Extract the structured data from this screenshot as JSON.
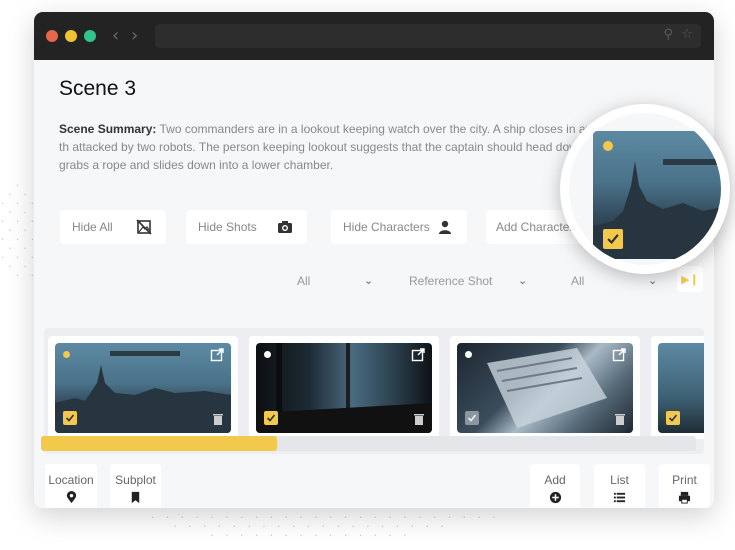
{
  "window": {
    "traffic_lights": [
      "#e8664a",
      "#f1c232",
      "#30c48d"
    ]
  },
  "scene": {
    "title": "Scene 3",
    "summary_label": "Scene Summary:",
    "summary_text": " Two commanders are in a lookout keeping watch over the city. A ship closes in around th attacked by two robots. The person keeping lookout suggests that the captain should head down to get grabs a rope and slides down into a lower chamber."
  },
  "toolbar": {
    "hide_all": "Hide All",
    "hide_shots": "Hide Shots",
    "hide_characters": "Hide Characters",
    "add_characters": "Add Characters"
  },
  "filters": {
    "filter1": "All",
    "filter2": "Reference Shot",
    "filter3": "All"
  },
  "shots": [
    {
      "flag_color": "#f2c94c",
      "checked": true
    },
    {
      "flag_color": "#ffffff",
      "checked": true
    },
    {
      "flag_color": "#ffffff",
      "checked": false
    },
    {
      "flag_color": "#f2c94c",
      "checked": true
    }
  ],
  "progress": {
    "value": 0.36
  },
  "bottom_tools": {
    "location": "Location",
    "subplot": "Subplot",
    "add": "Add",
    "list": "List",
    "print": "Print"
  },
  "accent_color": "#f2c94c",
  "icons": [
    "back-arrow-icon",
    "forward-arrow-icon",
    "search-icon",
    "star-icon",
    "image-off-icon",
    "camera-icon",
    "person-icon",
    "skip-forward-icon",
    "external-link-icon",
    "trash-icon",
    "checkbox-icon",
    "location-pin-icon",
    "bookmark-icon",
    "add-circle-icon",
    "list-icon",
    "printer-icon"
  ]
}
